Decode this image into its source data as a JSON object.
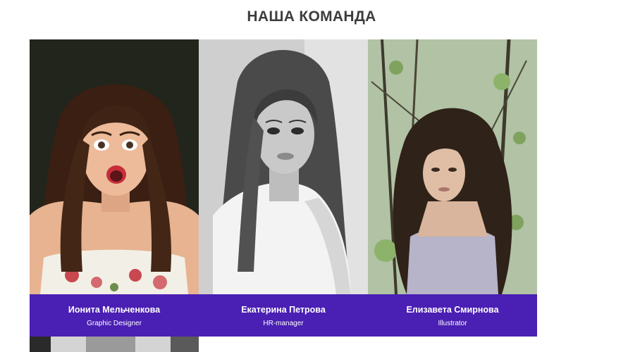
{
  "section": {
    "title": "НАША КОМАНДА"
  },
  "members": [
    {
      "name": "Ионита Мельченкова",
      "role": "Graphic Designer",
      "photo_icon": "portrait-surprised-woman"
    },
    {
      "name": "Екатерина Петрова",
      "role": "HR-manager",
      "photo_icon": "portrait-bw-woman"
    },
    {
      "name": "Елизавета Смирнова",
      "role": "Illustrator",
      "photo_icon": "portrait-woman-in-forest"
    }
  ],
  "colors": {
    "caption_background": "#4a1fb3",
    "title_text": "#3d3d3d"
  }
}
